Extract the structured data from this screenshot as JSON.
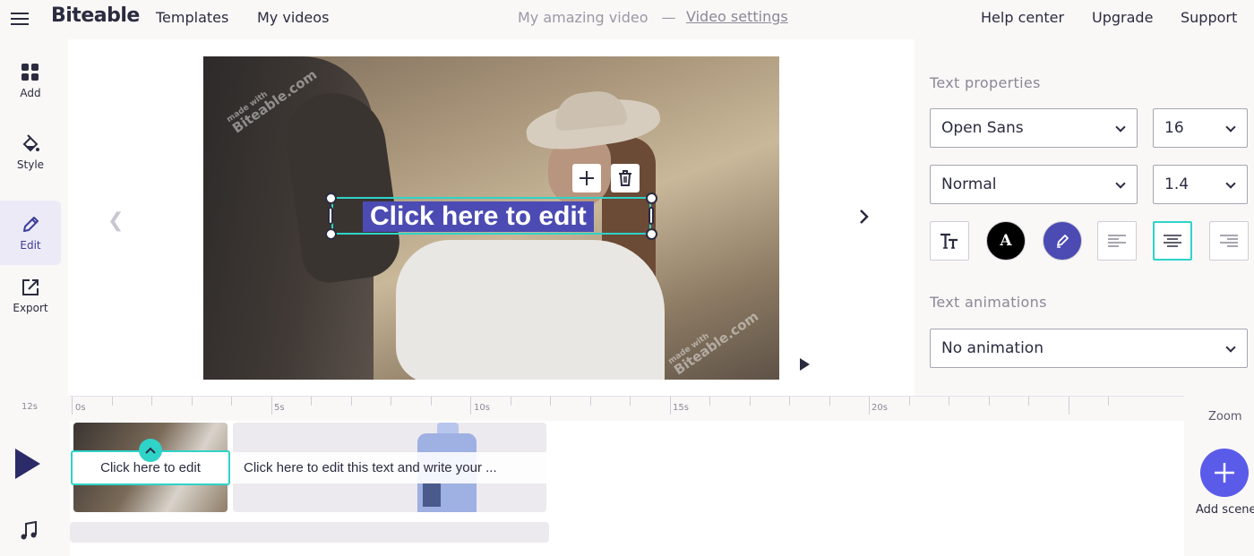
{
  "app": {
    "name": "Biteable"
  },
  "header": {
    "nav": [
      {
        "label": "Templates"
      },
      {
        "label": "My videos"
      }
    ],
    "video_title": "My amazing video",
    "separator": "—",
    "video_settings": "Video settings",
    "right_nav": [
      {
        "label": "Help center"
      },
      {
        "label": "Upgrade"
      },
      {
        "label": "Support"
      }
    ]
  },
  "sidebar": {
    "items": [
      {
        "label": "Add",
        "icon": "grid-icon"
      },
      {
        "label": "Style",
        "icon": "paint-bucket-icon"
      },
      {
        "label": "Edit",
        "icon": "pencil-icon",
        "active": true
      },
      {
        "label": "Export",
        "icon": "export-icon"
      }
    ]
  },
  "canvas": {
    "text": "Click here to edit",
    "watermark_small": "made with",
    "watermark": "Biteable.com"
  },
  "properties": {
    "heading": "Text properties",
    "font": "Open Sans",
    "size": "16",
    "weight": "Normal",
    "line_height": "1.4",
    "text_color": "#000000",
    "highlight_color": "#4b4bb3",
    "alignment": "center",
    "animations_heading": "Text animations",
    "animation": "No animation"
  },
  "timeline": {
    "duration": "12s",
    "ticks": [
      "0s",
      "5s",
      "10s",
      "15s",
      "20s"
    ],
    "clips": [
      {
        "text": "Click here to edit"
      },
      {
        "text": "Click here to edit this text and write your ..."
      }
    ],
    "zoom_label": "Zoom",
    "add_scene_label": "Add scene"
  },
  "colors": {
    "accent": "#2fd3c8",
    "primary": "#5b5bea",
    "text_highlight": "#4b4bb3"
  }
}
